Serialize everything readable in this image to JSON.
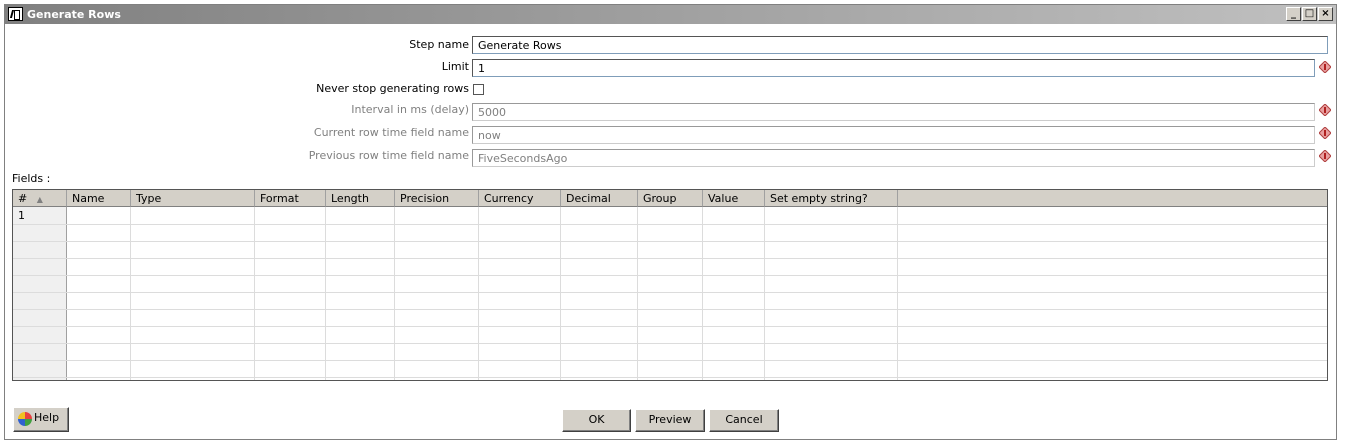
{
  "window": {
    "title": "Generate Rows",
    "controls": [
      "minimize",
      "maximize",
      "close"
    ]
  },
  "form": {
    "step_name_label": "Step name",
    "step_name_value": "Generate Rows",
    "limit_label": "Limit",
    "limit_value": "1",
    "never_stop_label": "Never stop generating rows",
    "never_stop_checked": false,
    "interval_label": "Interval in ms (delay)",
    "interval_value": "5000",
    "current_row_label": "Current row time field name",
    "current_row_value": "now",
    "previous_row_label": "Previous row time field name",
    "previous_row_value": "FiveSecondsAgo",
    "variable_icon": "variable-diamond-icon"
  },
  "fields": {
    "label": "Fields :",
    "columns": [
      "#",
      "Name",
      "Type",
      "Format",
      "Length",
      "Precision",
      "Currency",
      "Decimal",
      "Group",
      "Value",
      "Set empty string?"
    ],
    "sort_indicator": "▲",
    "rows": [
      [
        "1",
        "",
        "",
        "",
        "",
        "",
        "",
        "",
        "",
        "",
        ""
      ]
    ]
  },
  "buttons": {
    "help": "Help",
    "ok": "OK",
    "preview": "Preview",
    "cancel": "Cancel"
  },
  "colors": {
    "title_gradient_start": "#808080",
    "title_gradient_end": "#c0c0c0",
    "button_face": "#d4d0c8",
    "disabled_text": "#808080"
  }
}
